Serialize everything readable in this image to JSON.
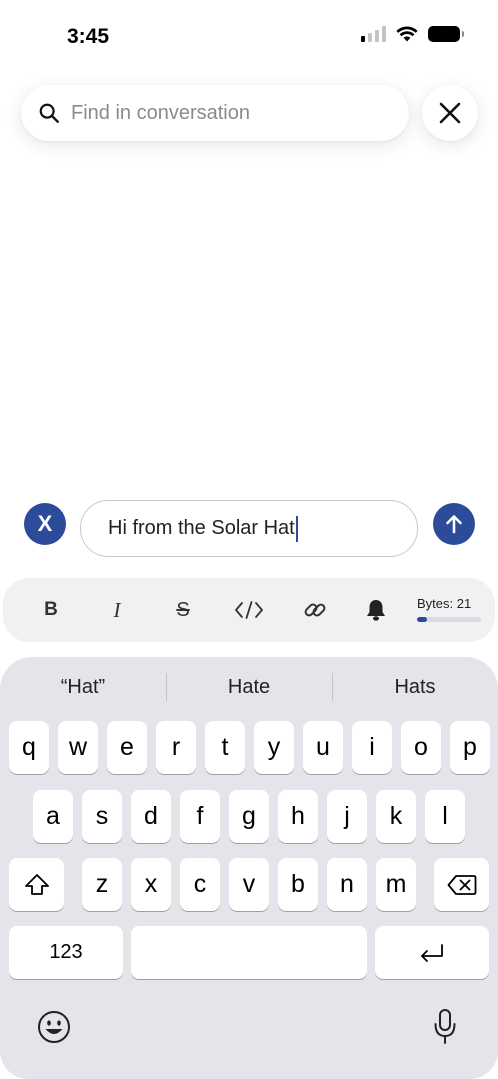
{
  "status": {
    "time": "3:45"
  },
  "search": {
    "placeholder": "Find in conversation"
  },
  "composer": {
    "clear_label": "X",
    "message": "Hi from the Solar Hat"
  },
  "format_bar": {
    "bold": "B",
    "italic": "I",
    "strike": "S",
    "bytes_label": "Bytes: 21",
    "bytes_fraction": 0.15
  },
  "keyboard": {
    "suggestions": [
      "“Hat”",
      "Hate",
      "Hats"
    ],
    "row1": [
      "q",
      "w",
      "e",
      "r",
      "t",
      "y",
      "u",
      "i",
      "o",
      "p"
    ],
    "row2": [
      "a",
      "s",
      "d",
      "f",
      "g",
      "h",
      "j",
      "k",
      "l"
    ],
    "row3": [
      "z",
      "x",
      "c",
      "v",
      "b",
      "n",
      "m"
    ],
    "numbers_key": "123"
  },
  "colors": {
    "accent": "#2c4b9a",
    "keyboard_bg": "#e4e5ea",
    "toolbar_bg": "#f1f1f3"
  }
}
